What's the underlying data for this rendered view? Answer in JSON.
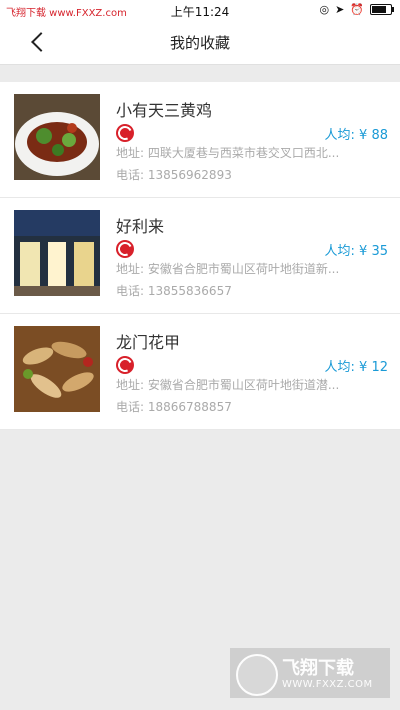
{
  "status_bar": {
    "carrier_text": "飞翔下载 www.FXXZ.com",
    "time": "上午11:24"
  },
  "navbar": {
    "title": "我的收藏"
  },
  "favorites": [
    {
      "name": "小有天三黄鸡",
      "price": "人均: ¥ 88",
      "address": "地址:  四联大厦巷与西菜市巷交叉口西北...",
      "phone": "电话:  13856962893",
      "image_type": "dish"
    },
    {
      "name": "好利来",
      "price": "人均: ¥ 35",
      "address": "地址:  安徽省合肥市蜀山区荷叶地街道新...",
      "phone": "电话:  13855836657",
      "image_type": "storefront"
    },
    {
      "name": "龙门花甲",
      "price": "人均: ¥ 12",
      "address": "地址:  安徽省合肥市蜀山区荷叶地街道潜...",
      "phone": "电话:  18866788857",
      "image_type": "dish"
    }
  ],
  "watermark": {
    "text": "飞翔下载",
    "url": "WWW.FXXZ.COM"
  }
}
